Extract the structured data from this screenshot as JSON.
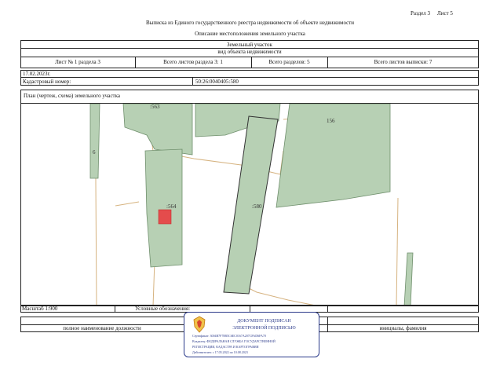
{
  "header": {
    "section": "Раздел 3",
    "sheet": "Лист 5",
    "title": "Выписка из Единого государственного реестра недвижимости об объекте недвижимости",
    "subtitle": "Описание местоположения земельного участка"
  },
  "object": {
    "type": "Земельный участок",
    "caption": "вид объекта недвижимости"
  },
  "sheet_info": {
    "sheet_no": "Лист № 1 раздела 3",
    "total_sheets_section": "Всего листов раздела 3: 1",
    "total_sections": "Всего разделов: 5",
    "total_sheets_extract": "Всего листов выписки: 7"
  },
  "date": "17.02.2023г.",
  "cadastral": {
    "label": "Кадастровый номер:",
    "value": "50:26:0040405:580"
  },
  "plan_title": "План (чертеж, схема) земельного участка",
  "map_labels": {
    "p563": ":563",
    "p156": "156",
    "p6": "6",
    "p564": ":564",
    "p580": ":580"
  },
  "footer": {
    "scale": "Масштаб 1:900",
    "legend": "Условные обозначения:",
    "position": "полное наименование должности",
    "signature_name": "инициалы, фамилия"
  },
  "stamp": {
    "line1": "ДОКУМЕНТ ПОДПИСАН",
    "line2": "ЭЛЕКТРОННОЙ ПОДПИСЬЮ",
    "cert": "Сертификат: 3004B7F78B5C6EC0167A207CFAD6FA70",
    "owner1": "Владелец: ФЕДЕРАЛЬНАЯ СЛУЖБА ГОСУДАРСТВЕННОЙ",
    "owner2": "РЕГИСТРАЦИИ, КАДАСТРА И КАРТОГРАФИИ",
    "valid": "Действителен: с 17.05.2022 по 10.08.2023"
  },
  "colors": {
    "parcel_fill": "#b7d0b4",
    "parcel_stroke": "#6f8f6c",
    "boundary": "#d6b380",
    "highlight": "#e44c4c",
    "stamp": "#2b3a8a"
  }
}
